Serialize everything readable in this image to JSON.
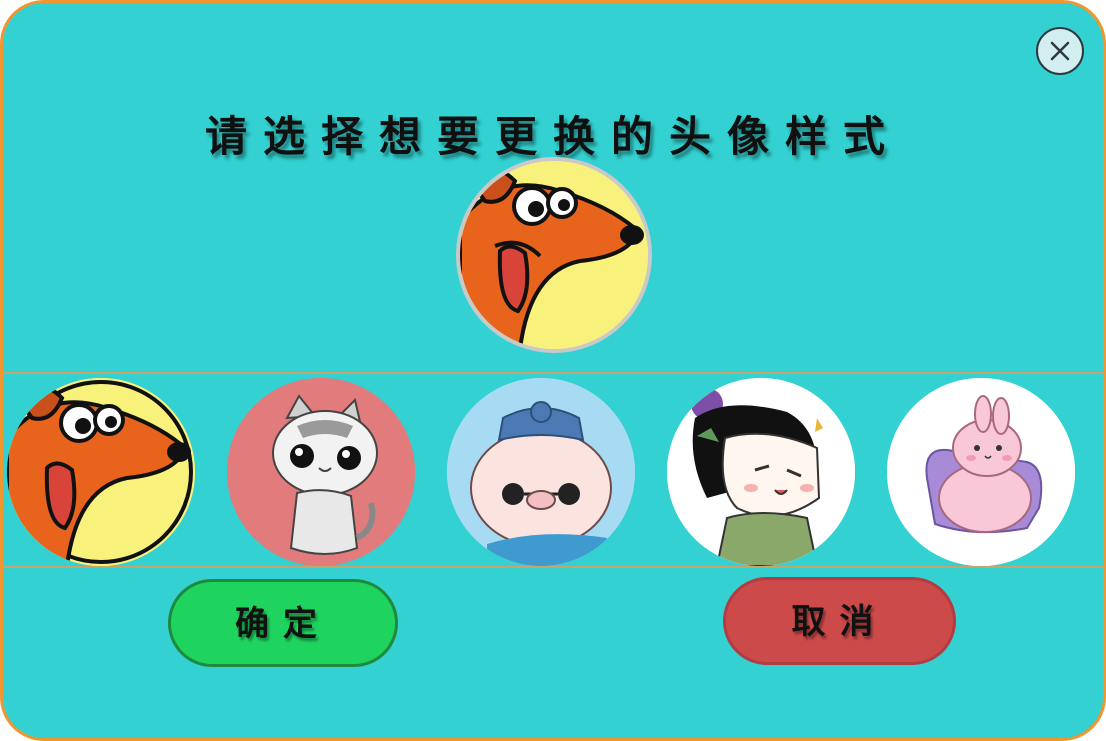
{
  "dialog": {
    "title": "请选择想要更换的头像样式",
    "close_icon": "close-icon",
    "colors": {
      "background": "#33d1d1",
      "border": "#f0962e",
      "confirm": "#1fd35f",
      "cancel": "#cc4a4a"
    }
  },
  "current_avatar": {
    "icon": "dog-avatar"
  },
  "avatar_options": [
    {
      "icon": "dog-avatar",
      "background": "#f8f27c"
    },
    {
      "icon": "cat-avatar",
      "background": "#e27b7b"
    },
    {
      "icon": "pig-avatar",
      "background": "#a7dbf3"
    },
    {
      "icon": "girl-avatar",
      "background": "#ffffff"
    },
    {
      "icon": "rabbit-avatar",
      "background": "#ffffff"
    }
  ],
  "buttons": {
    "confirm_label": "确定",
    "cancel_label": "取消"
  }
}
